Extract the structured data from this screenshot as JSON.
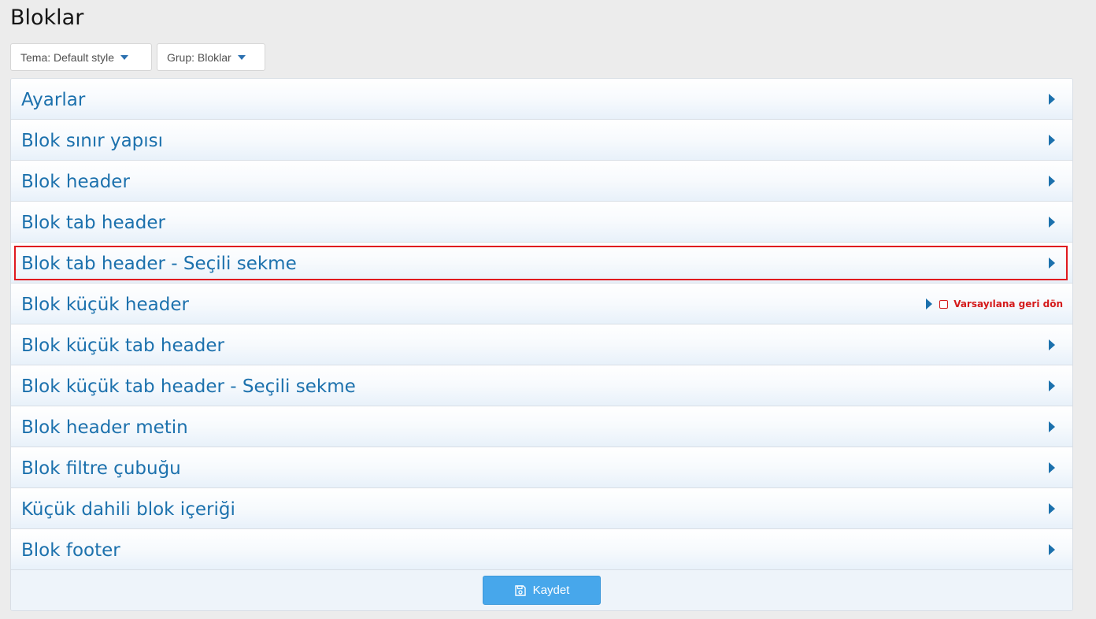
{
  "page": {
    "title": "Bloklar"
  },
  "filters": {
    "theme_label": "Tema: Default style",
    "group_label": "Grup: Bloklar"
  },
  "rows": [
    {
      "label": "Ayarlar"
    },
    {
      "label": "Blok sınır yapısı"
    },
    {
      "label": "Blok header"
    },
    {
      "label": "Blok tab header"
    },
    {
      "label": "Blok tab header - Seçili sekme"
    },
    {
      "label": "Blok küçük header"
    },
    {
      "label": "Blok küçük tab header"
    },
    {
      "label": "Blok küçük tab header - Seçili sekme"
    },
    {
      "label": "Blok header metin"
    },
    {
      "label": "Blok filtre çubuğu"
    },
    {
      "label": "Küçük dahili blok içeriği"
    },
    {
      "label": "Blok footer"
    }
  ],
  "revert": {
    "label": "Varsayılana geri dön"
  },
  "footer": {
    "save_label": "Kaydet"
  },
  "icons": {
    "dropdown": "caret-down-icon",
    "expand": "caret-right-icon",
    "save": "floppy-disk-icon",
    "checkbox": "checkbox-icon"
  },
  "colors": {
    "link": "#1c71ad",
    "save_button": "#47a7eb",
    "highlight": "#e0191f",
    "revert": "#d41a1a"
  }
}
